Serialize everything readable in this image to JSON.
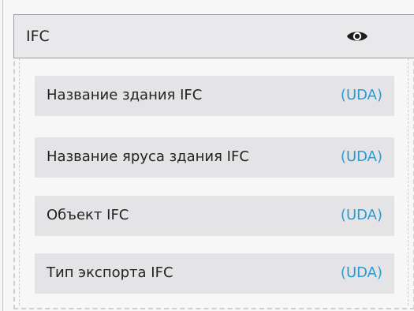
{
  "group": {
    "title": "IFC",
    "visibility_icon": "eye-icon"
  },
  "items": [
    {
      "label": "Название здания IFC",
      "tag": "(UDA)"
    },
    {
      "label": "Название яруса здания IFC",
      "tag": "(UDA)"
    },
    {
      "label": "Объект IFC",
      "tag": "(UDA)"
    },
    {
      "label": "Тип экспорта IFC",
      "tag": "(UDA)"
    }
  ],
  "colors": {
    "tag": "#2a9ad3",
    "header_bg": "#e9e9eb",
    "item_bg": "#e4e4e6"
  }
}
